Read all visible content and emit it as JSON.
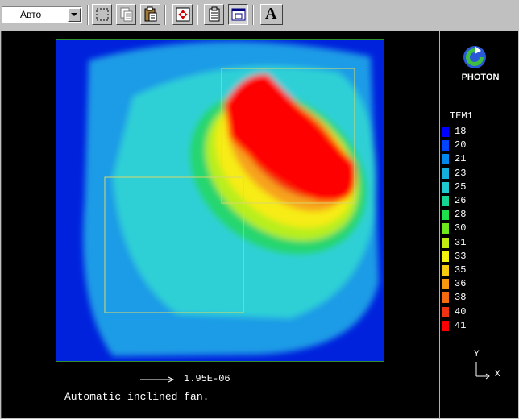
{
  "toolbar": {
    "view_select_value": "Авто",
    "text_tool_label": "A",
    "buttons": [
      "select-rect-icon",
      "copy-icon",
      "paste-icon",
      "fit-view-icon",
      "properties-icon",
      "window-mode-icon",
      "text-icon"
    ]
  },
  "plot": {
    "scale_value": "1.95E-06",
    "caption": "Automatic inclined fan.",
    "field_colors": [
      "#0022dd",
      "#1e9be6",
      "#2fd0d6",
      "#27d66e",
      "#b8ee1c",
      "#f7ec18",
      "#f7a21a",
      "#ee3a12",
      "#ff0000"
    ]
  },
  "legend": {
    "brand": "PHOTON",
    "variable": "TEM1",
    "items": [
      {
        "label": "18",
        "color": "#0000ff"
      },
      {
        "label": "20",
        "color": "#0044ff"
      },
      {
        "label": "21",
        "color": "#0088ee"
      },
      {
        "label": "23",
        "color": "#13aedc"
      },
      {
        "label": "25",
        "color": "#1fc8d0"
      },
      {
        "label": "26",
        "color": "#16d494"
      },
      {
        "label": "28",
        "color": "#1ee04a"
      },
      {
        "label": "30",
        "color": "#6ee81c"
      },
      {
        "label": "31",
        "color": "#c0ec12"
      },
      {
        "label": "33",
        "color": "#f3f10f"
      },
      {
        "label": "35",
        "color": "#f7c90f"
      },
      {
        "label": "36",
        "color": "#f79a10"
      },
      {
        "label": "38",
        "color": "#f46a10"
      },
      {
        "label": "40",
        "color": "#ee3212"
      },
      {
        "label": "41",
        "color": "#ff0000"
      }
    ],
    "axis_y": "Y",
    "axis_x": "X"
  }
}
